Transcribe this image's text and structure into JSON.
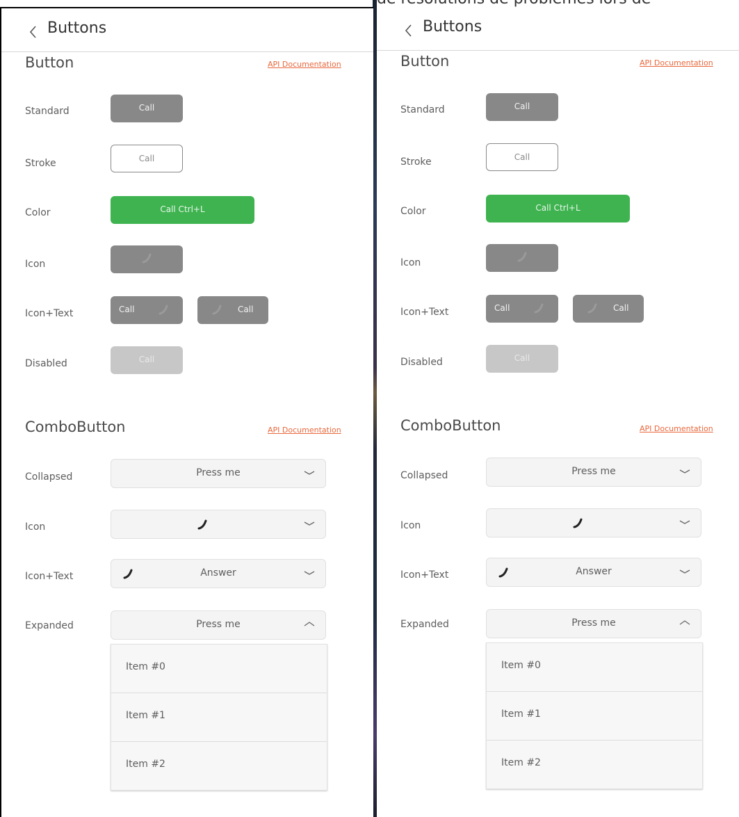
{
  "top_snippet": "de résolutions de problèmes lors de",
  "header": {
    "title": "Buttons"
  },
  "button_section": {
    "title": "Button",
    "api_link": "API Documentation",
    "rows": {
      "standard": {
        "label": "Standard",
        "button": "Call"
      },
      "stroke": {
        "label": "Stroke",
        "button": "Call"
      },
      "color": {
        "label": "Color",
        "button": "Call Ctrl+L"
      },
      "icon": {
        "label": "Icon"
      },
      "icon_text": {
        "label": "Icon+Text",
        "button_a": "Call",
        "button_b": "Call"
      },
      "disabled": {
        "label": "Disabled",
        "button": "Call"
      }
    }
  },
  "combo_section": {
    "title": "ComboButton",
    "api_link": "API Documentation",
    "rows": {
      "collapsed": {
        "label": "Collapsed",
        "button": "Press me"
      },
      "icon": {
        "label": "Icon"
      },
      "icon_text": {
        "label": "Icon+Text",
        "button": "Answer"
      },
      "expanded": {
        "label": "Expanded",
        "button": "Press me"
      }
    },
    "items": [
      "Item #0",
      "Item #1",
      "Item #2"
    ]
  },
  "colors": {
    "standard": "#888888",
    "color_button": "#3eb34f",
    "disabled": "#c7c7c7",
    "link": "#e9673b"
  },
  "icons": {
    "back": "chevron-left-icon",
    "phone": "phone-icon",
    "chevron_down": "chevron-down-icon",
    "chevron_up": "chevron-up-icon"
  }
}
